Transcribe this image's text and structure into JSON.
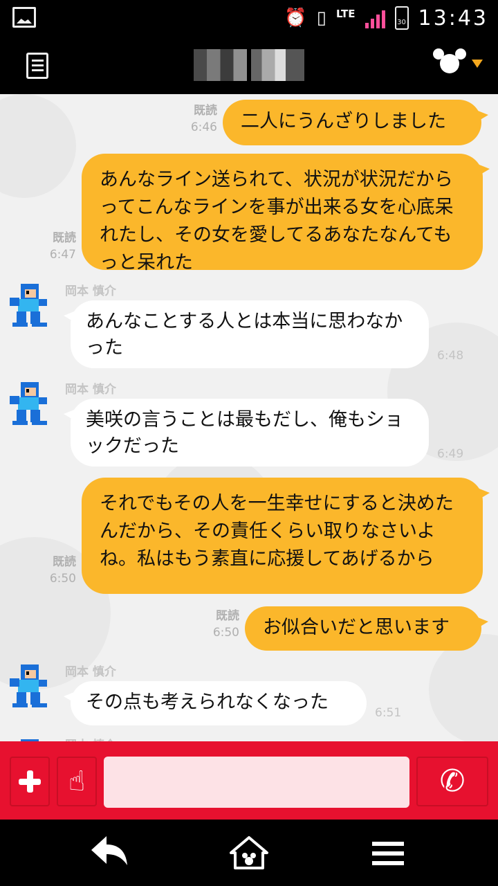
{
  "status_bar": {
    "network": "LTE",
    "battery": "30",
    "time": "13:43"
  },
  "header": {
    "contact_name_blurred": true,
    "menu_icon": "scroll-icon",
    "mascot_icon": "mouse-head-icon"
  },
  "messages": [
    {
      "dir": "out",
      "read": "既読",
      "time": "6:46",
      "text": "二人にうんざりしました"
    },
    {
      "dir": "out",
      "read": "既読",
      "time": "6:47",
      "text": "あんなライン送られて、状況が状況だからってこんなラインを事が出来る女を心底呆れたし、その女を愛してるあなたなんてもっと呆れた"
    },
    {
      "dir": "in",
      "sender": "岡本 慎介",
      "time": "6:48",
      "text": "あんなことする人とは本当に思わなかった"
    },
    {
      "dir": "in",
      "sender": "岡本 慎介",
      "time": "6:49",
      "text": "美咲の言うことは最もだし、俺もショックだった"
    },
    {
      "dir": "out",
      "read": "既読",
      "time": "6:50",
      "text": "それでもその人を一生幸せにすると決めたんだから、その責任くらい取りなさいよね。私はもう素直に応援してあげるから"
    },
    {
      "dir": "out",
      "read": "既読",
      "time": "6:50",
      "text": "お似合いだと思います"
    },
    {
      "dir": "in",
      "sender": "岡本 慎介",
      "time": "6:51",
      "text": "その点も考えられなくなった"
    },
    {
      "dir": "in",
      "sender": "岡本 慎介",
      "time": "",
      "text": ""
    }
  ],
  "input": {
    "placeholder": "",
    "value": ""
  },
  "colors": {
    "outgoing_bubble": "#fbb72b",
    "incoming_bubble": "#ffffff",
    "input_bar": "#e7112f"
  }
}
